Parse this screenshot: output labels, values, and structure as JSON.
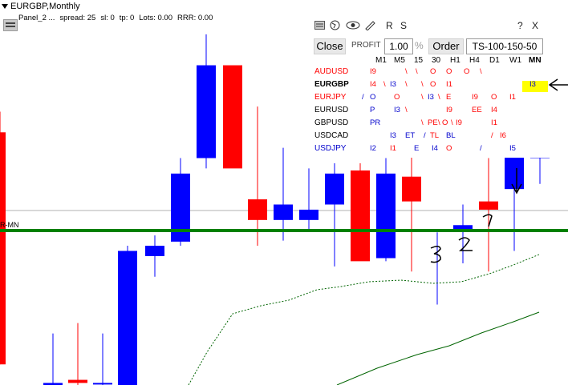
{
  "window": {
    "title": "EURGBP,Monthly"
  },
  "panel_status": {
    "label": "Panel_2 ...",
    "spread": "spread: 25",
    "sl": "sl: 0",
    "tp": "tp: 0",
    "lots": "Lots: 0.00",
    "rrr": "RRR: 0.00"
  },
  "chart_label": "R-MN",
  "colors": {
    "bull": "#0000ff",
    "bear": "#ff0000",
    "line": "#008000",
    "ma": "#006400",
    "red_text": "#ff0000",
    "blue_text": "#0000cc"
  },
  "icons": [
    "layout-icon",
    "globe-icon",
    "eye-icon",
    "pencil-icon"
  ],
  "toolbar": {
    "r": "R",
    "s": "S",
    "help": "?",
    "close_x": "X"
  },
  "controls": {
    "close": "Close",
    "profit": "PROFIT",
    "profit_value": "1.00",
    "percent": "%",
    "order": "Order",
    "ts_value": "TS-100-150-50"
  },
  "timeframes": [
    "M1",
    "M5",
    "15",
    "30",
    "H1",
    "H4",
    "D1",
    "W1",
    "MN"
  ],
  "symbols": [
    {
      "name": "AUDUSD",
      "color": "#ff0000",
      "bold": false,
      "cells": [
        [
          "I9",
          "#ff0000",
          73
        ],
        [
          "\\",
          "#ff0000",
          117
        ],
        [
          "\\",
          "#ff0000",
          130
        ],
        [
          "O",
          "#ff0000",
          148
        ],
        [
          "O",
          "#ff0000",
          168
        ],
        [
          "O",
          "#ff0000",
          190
        ],
        [
          "\\",
          "#ff0000",
          210
        ]
      ]
    },
    {
      "name": "EURGBP",
      "color": "#000000",
      "bold": true,
      "cells": [
        [
          "I4",
          "#ff0000",
          73
        ],
        [
          "\\",
          "#ff0000",
          90
        ],
        [
          "I3",
          "#0000cc",
          98
        ],
        [
          "\\",
          "#ff0000",
          117
        ],
        [
          "\\",
          "#ff0000",
          137
        ],
        [
          "O",
          "#ff0000",
          148
        ],
        [
          "I1",
          "#ff0000",
          168
        ],
        [
          "I3",
          "#0000cc",
          272
        ]
      ]
    },
    {
      "name": "EURJPY",
      "color": "#ff0000",
      "bold": false,
      "cells": [
        [
          "/",
          "#0000cc",
          63
        ],
        [
          "O",
          "#0000cc",
          73
        ],
        [
          "O",
          "#ff0000",
          103
        ],
        [
          "\\",
          "#ff0000",
          137
        ],
        [
          "I3",
          "#0000cc",
          145
        ],
        [
          "\\",
          "#ff0000",
          158
        ],
        [
          "E",
          "#ff0000",
          168
        ],
        [
          "I9",
          "#ff0000",
          200
        ],
        [
          "O",
          "#ff0000",
          224
        ],
        [
          "I1",
          "#ff0000",
          247
        ]
      ]
    },
    {
      "name": "EURUSD",
      "color": "#000000",
      "bold": false,
      "cells": [
        [
          "P",
          "#0000cc",
          73
        ],
        [
          "I3",
          "#0000cc",
          103
        ],
        [
          "\\",
          "#ff0000",
          117
        ],
        [
          "I9",
          "#ff0000",
          168
        ],
        [
          "EE",
          "#ff0000",
          200
        ],
        [
          "I4",
          "#ff0000",
          224
        ]
      ]
    },
    {
      "name": "GBPUSD",
      "color": "#000000",
      "bold": false,
      "cells": [
        [
          "PR",
          "#0000cc",
          73
        ],
        [
          "\\",
          "#ff0000",
          137
        ],
        [
          "PE",
          "#ff0000",
          145
        ],
        [
          "\\",
          "#ff0000",
          158
        ],
        [
          "O",
          "#ff0000",
          163
        ],
        [
          "\\",
          "#ff0000",
          174
        ],
        [
          "I9",
          "#ff0000",
          180
        ],
        [
          "I1",
          "#ff0000",
          224
        ]
      ]
    },
    {
      "name": "USDCAD",
      "color": "#000000",
      "bold": false,
      "cells": [
        [
          "I3",
          "#0000cc",
          98
        ],
        [
          "ET",
          "#0000cc",
          117
        ],
        [
          "/",
          "#0000cc",
          140
        ],
        [
          "TL",
          "#ff0000",
          148
        ],
        [
          "BL",
          "#0000cc",
          168
        ],
        [
          "/",
          "#ff0000",
          224
        ],
        [
          "I6",
          "#ff0000",
          235
        ]
      ]
    },
    {
      "name": "USDJPY",
      "color": "#0000cc",
      "bold": false,
      "cells": [
        [
          "I2",
          "#0000cc",
          73
        ],
        [
          "I1",
          "#ff0000",
          98
        ],
        [
          "E",
          "#0000cc",
          128
        ],
        [
          "I4",
          "#0000cc",
          150
        ],
        [
          "O",
          "#ff0000",
          168
        ],
        [
          "/",
          "#0000cc",
          210
        ],
        [
          "I5",
          "#0000cc",
          247
        ]
      ]
    }
  ],
  "annotations": {
    "n1": "1",
    "n2": "2",
    "n3": "3"
  },
  "chart_data": {
    "type": "candlestick",
    "title": "EURGBP,Monthly",
    "ylabel": "",
    "xlabel": "",
    "candles": [
      {
        "o": 0.885,
        "h": 0.905,
        "l": 0.66,
        "c": 0.66
      },
      {
        "o": 0.64,
        "h": 0.69,
        "l": 0.64,
        "c": 0.642
      },
      {
        "o": 0.645,
        "h": 0.7,
        "l": 0.64,
        "c": 0.642
      },
      {
        "o": 0.642,
        "h": 0.69,
        "l": 0.64,
        "c": 0.642
      },
      {
        "o": 0.64,
        "h": 0.775,
        "l": 0.64,
        "c": 0.77
      },
      {
        "o": 0.765,
        "h": 0.785,
        "l": 0.745,
        "c": 0.775
      },
      {
        "o": 0.779,
        "h": 0.86,
        "l": 0.775,
        "c": 0.845
      },
      {
        "o": 0.86,
        "h": 0.98,
        "l": 0.85,
        "c": 0.95
      },
      {
        "o": 0.95,
        "h": 0.935,
        "l": 0.895,
        "c": 0.85
      },
      {
        "o": 0.82,
        "h": 0.91,
        "l": 0.775,
        "c": 0.8
      },
      {
        "o": 0.8,
        "h": 0.87,
        "l": 0.78,
        "c": 0.815
      },
      {
        "o": 0.8,
        "h": 0.85,
        "l": 0.79,
        "c": 0.81
      },
      {
        "o": 0.815,
        "h": 0.855,
        "l": 0.755,
        "c": 0.845
      },
      {
        "o": 0.848,
        "h": 0.855,
        "l": 0.765,
        "c": 0.76
      },
      {
        "o": 0.763,
        "h": 0.86,
        "l": 0.76,
        "c": 0.845
      },
      {
        "o": 0.842,
        "h": 0.88,
        "l": 0.75,
        "c": 0.818
      },
      {
        "o": 0.79,
        "h": 0.788,
        "l": 0.718,
        "c": 0.79
      },
      {
        "o": 0.79,
        "h": 0.815,
        "l": 0.758,
        "c": 0.795
      },
      {
        "o": 0.818,
        "h": 0.86,
        "l": 0.75,
        "c": 0.81
      },
      {
        "o": 0.83,
        "h": 0.885,
        "l": 0.77,
        "c": 0.863
      },
      {
        "o": 0.86,
        "h": 0.895,
        "l": 0.835,
        "c": 0.87
      }
    ],
    "ylim": [
      0.64,
      0.99
    ],
    "hline": 0.8615
  }
}
